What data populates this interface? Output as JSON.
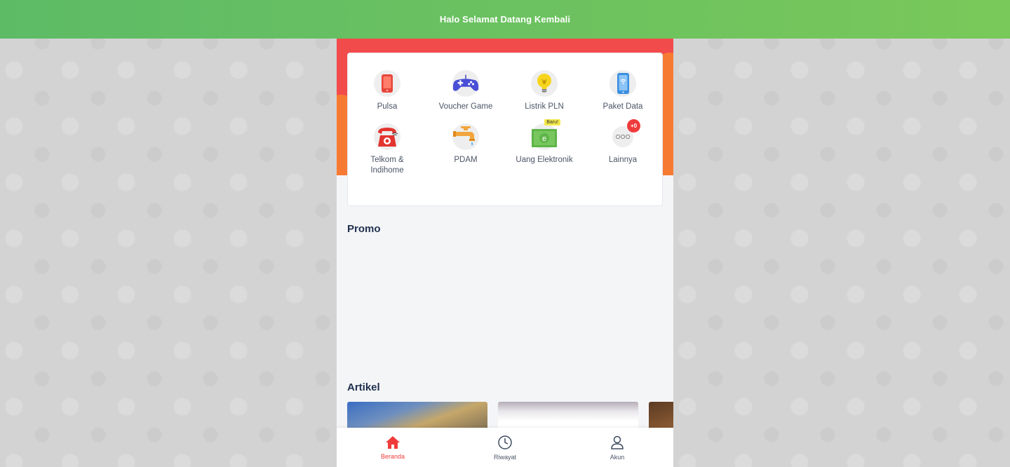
{
  "header": {
    "greeting": "Halo Selamat Datang Kembali"
  },
  "menu": {
    "items": [
      {
        "label": "Pulsa",
        "icon": "phone-icon"
      },
      {
        "label": "Voucher Game",
        "icon": "gamepad-icon"
      },
      {
        "label": "Listrik PLN",
        "icon": "lightbulb-icon"
      },
      {
        "label": "Paket Data",
        "icon": "phone-wifi-icon"
      },
      {
        "label": "Telkom & Indihome",
        "icon": "telephone-icon"
      },
      {
        "label": "PDAM",
        "icon": "faucet-icon"
      },
      {
        "label": "Uang Elektronik",
        "icon": "money-icon",
        "tag": "Baru!"
      },
      {
        "label": "Lainnya",
        "icon": "more-icon",
        "badge": "+0"
      }
    ]
  },
  "sections": {
    "promo": "Promo",
    "artikel": "Artikel"
  },
  "bottom_nav": {
    "items": [
      {
        "label": "Beranda",
        "icon": "home-icon",
        "active": true
      },
      {
        "label": "Riwayat",
        "icon": "clock-icon",
        "active": false
      },
      {
        "label": "Akun",
        "icon": "user-icon",
        "active": false
      }
    ]
  },
  "colors": {
    "accent": "#ef3b3b",
    "header_green": "#6cc05f",
    "hero_red": "#f24b4b",
    "hero_orange": "#f77a33"
  }
}
